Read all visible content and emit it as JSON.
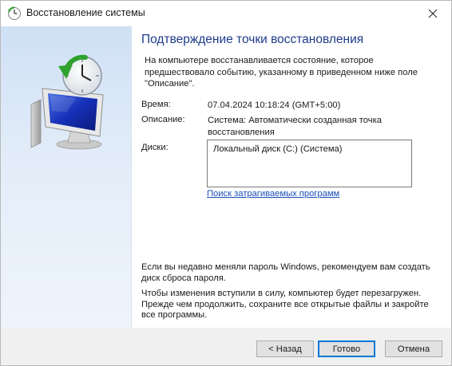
{
  "window": {
    "title": "Восстановление системы"
  },
  "main": {
    "heading": "Подтверждение точки восстановления",
    "intro": "На компьютере восстанавливается состояние, которое предшествовало событию, указанному в приведенном ниже поле \"Описание\".",
    "time_label": "Время:",
    "time_value": "07.04.2024 10:18:24 (GMT+5:00)",
    "description_label": "Описание:",
    "description_value": "Система: Автоматически созданная точка восстановления",
    "disks_label": "Диски:",
    "disks": [
      "Локальный диск (C:) (Система)"
    ],
    "affected_programs_link": "Поиск затрагиваемых программ",
    "password_note": "Если вы недавно меняли пароль Windows, рекомендуем вам создать диск сброса пароля.",
    "restart_note": "Чтобы изменения вступили в силу, компьютер будет перезагружен. Прежде чем продолжить, сохраните все открытые файлы и закройте все программы."
  },
  "buttons": {
    "back": "< Назад",
    "finish": "Готово",
    "cancel": "Отмена"
  },
  "colors": {
    "heading": "#1e3b8a",
    "link": "#1a4fb8",
    "sidebar_top": "#cfe0f5",
    "sidebar_bottom": "#eef4fb",
    "primary_border": "#0078d7"
  },
  "icons": {
    "title": "system-restore-icon",
    "hero": "system-restore-monitor-clock-icon",
    "close": "close-icon"
  }
}
